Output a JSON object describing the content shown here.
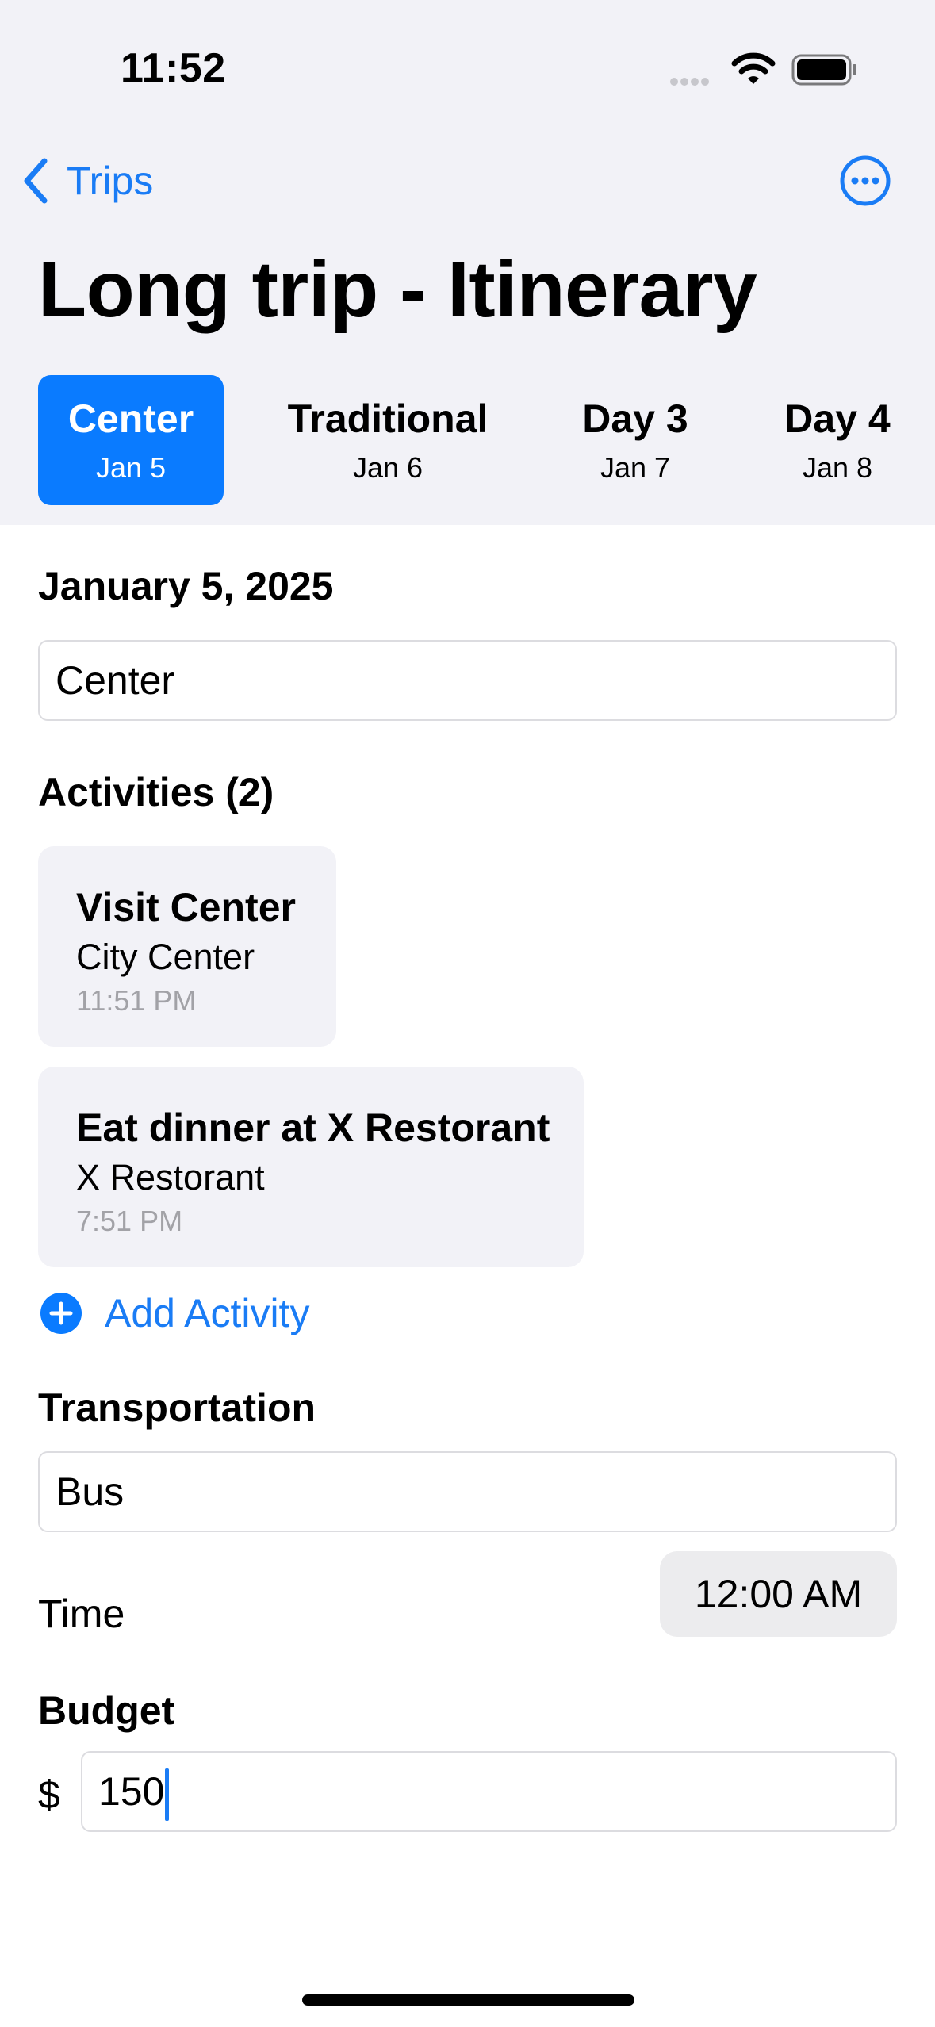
{
  "status_bar": {
    "time": "11:52"
  },
  "nav": {
    "back_label": "Trips",
    "title": "Long trip - Itinerary",
    "more_icon": "ellipsis-circle-icon",
    "accent_color": "#1a7cf5"
  },
  "day_tabs": [
    {
      "name": "Center",
      "date": "Jan 5",
      "selected": true
    },
    {
      "name": "Traditional",
      "date": "Jan 6",
      "selected": false
    },
    {
      "name": "Day 3",
      "date": "Jan 7",
      "selected": false
    },
    {
      "name": "Day 4",
      "date": "Jan 8",
      "selected": false
    }
  ],
  "day_detail": {
    "date_heading": "January 5, 2025",
    "name_value": "Center",
    "activities_heading": "Activities (2)",
    "activities": [
      {
        "title": "Visit Center",
        "place": "City Center",
        "time": "11:51 PM"
      },
      {
        "title": "Eat dinner at X Restorant",
        "place": "X Restorant",
        "time": "7:51 PM"
      }
    ],
    "add_activity_label": "Add Activity",
    "transportation_heading": "Transportation",
    "transportation_value": "Bus",
    "time_label": "Time",
    "time_value": "12:00 AM",
    "budget_heading": "Budget",
    "currency_symbol": "$",
    "budget_value": "150"
  },
  "colors": {
    "selected_tab": "#0a7bff",
    "header_background": "#f2f2f7",
    "card_background": "#f2f2f7"
  }
}
